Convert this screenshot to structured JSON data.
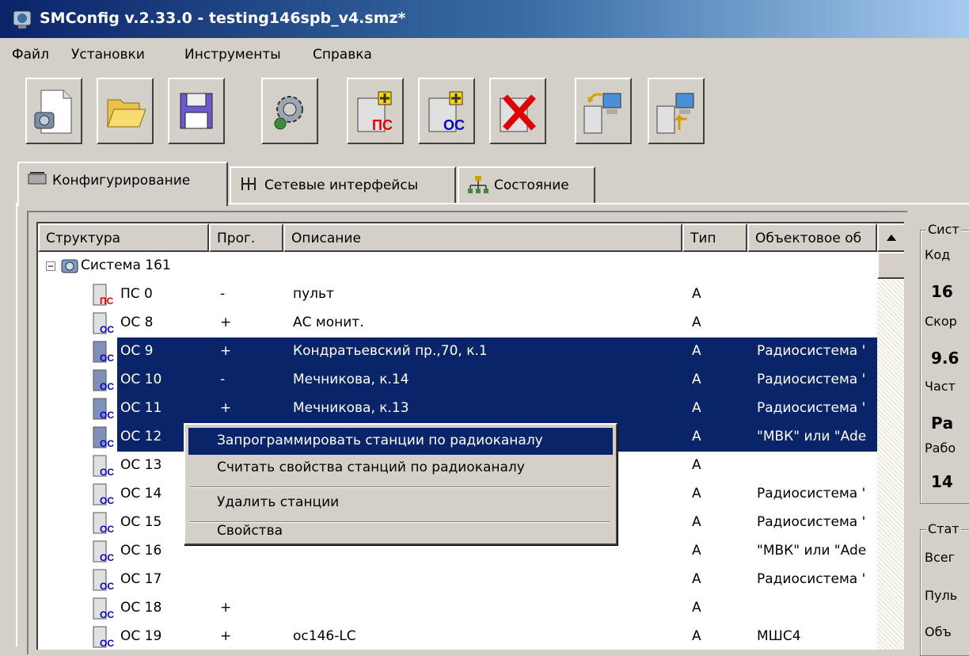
{
  "window": {
    "title": "SMConfig v.2.33.0 - testing146spb_v4.smz*"
  },
  "menu": [
    "Файл",
    "Установки",
    "Инструменты",
    "Справка"
  ],
  "toolbar": {
    "buttons": [
      "new-config",
      "open",
      "save",
      "settings",
      "add-ps",
      "add-os",
      "delete",
      "read-stations",
      "write-stations"
    ],
    "ps_label": "ПС",
    "os_label": "ОС"
  },
  "tabs": [
    {
      "label": "Конфигурирование",
      "active": true
    },
    {
      "label": "Сетевые интерфейсы",
      "active": false
    },
    {
      "label": "Состояние",
      "active": false
    }
  ],
  "list": {
    "columns": [
      "Структура",
      "Прог.",
      "Описание",
      "Тип",
      "Объектовое об"
    ],
    "root": "Система 161",
    "rows": [
      {
        "icon": "ПС",
        "name": "ПС 0",
        "prog": "-",
        "desc": "пульт",
        "type": "A",
        "obj": "",
        "selected": false
      },
      {
        "icon": "ОС",
        "name": "ОС 8",
        "prog": "+",
        "desc": "АС монит.",
        "type": "A",
        "obj": "",
        "selected": false
      },
      {
        "icon": "ОС",
        "name": "ОС 9",
        "prog": "+",
        "desc": "Кондратьевский пр.,70, к.1",
        "type": "A",
        "obj": "Радиосистема '",
        "selected": true
      },
      {
        "icon": "ОС",
        "name": "ОС 10",
        "prog": "-",
        "desc": "Мечникова, к.14",
        "type": "A",
        "obj": "Радиосистема '",
        "selected": true
      },
      {
        "icon": "ОС",
        "name": "ОС 11",
        "prog": "+",
        "desc": "Мечникова, к.13",
        "type": "A",
        "obj": "Радиосистема '",
        "selected": true
      },
      {
        "icon": "ОС",
        "name": "ОС 12",
        "prog": "",
        "desc": "",
        "type": "A",
        "obj": "\"МВК\" или \"Ade",
        "selected": true
      },
      {
        "icon": "ОС",
        "name": "ОС 13",
        "prog": "",
        "desc": "",
        "type": "A",
        "obj": "",
        "selected": false
      },
      {
        "icon": "ОС",
        "name": "ОС 14",
        "prog": "",
        "desc": "",
        "type": "A",
        "obj": "Радиосистема '",
        "selected": false
      },
      {
        "icon": "ОС",
        "name": "ОС 15",
        "prog": "",
        "desc": "",
        "type": "A",
        "obj": "Радиосистема '",
        "selected": false
      },
      {
        "icon": "ОС",
        "name": "ОС 16",
        "prog": "",
        "desc": "",
        "type": "A",
        "obj": "\"МВК\" или \"Ade",
        "selected": false
      },
      {
        "icon": "ОС",
        "name": "ОС 17",
        "prog": "",
        "desc": "",
        "type": "A",
        "obj": "Радиосистема '",
        "selected": false
      },
      {
        "icon": "ОС",
        "name": "ОС 18",
        "prog": "+",
        "desc": "",
        "type": "A",
        "obj": "",
        "selected": false
      },
      {
        "icon": "ОС",
        "name": "ОС 19",
        "prog": "+",
        "desc": "ос146-LC",
        "type": "A",
        "obj": "МШС4",
        "selected": false
      }
    ]
  },
  "context_menu": {
    "items": [
      {
        "label": "Запрограммировать станции по радиоканалу",
        "highlighted": true
      },
      {
        "label": "Считать свойства станций по радиоканалу",
        "highlighted": false
      },
      {
        "label": "Удалить станции",
        "highlighted": false
      },
      {
        "label": "Свойства",
        "highlighted": false
      }
    ]
  },
  "right_panel": {
    "system_group_title": "Сист",
    "fields": [
      {
        "label": "Код",
        "value": "16"
      },
      {
        "label": "Скор",
        "value": "9.6"
      },
      {
        "label": "Част",
        "value": "Ра"
      },
      {
        "label": "Рабо",
        "value": "14"
      }
    ],
    "stats_group_title": "Стат",
    "stats_labels": [
      "Всег",
      "Пуль",
      "Объ"
    ]
  },
  "colors": {
    "selection": "#0a246a",
    "face": "#d4d0c8",
    "ps_red": "#e00000",
    "os_blue": "#0000cc"
  }
}
